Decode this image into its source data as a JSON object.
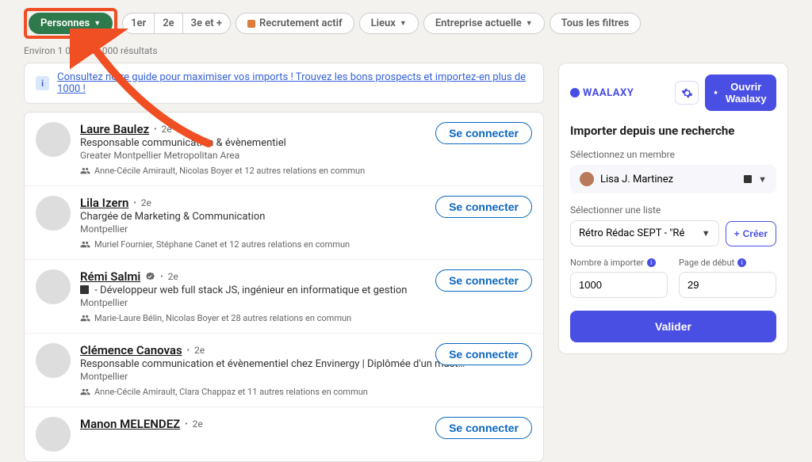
{
  "filters": {
    "primary": "Personnes",
    "seg1": "1er",
    "seg2": "2e",
    "seg3": "3e et +",
    "recruiting": "Recrutement actif",
    "locations": "Lieux",
    "company": "Entreprise actuelle",
    "all": "Tous les filtres"
  },
  "results_count": "Environ 1 080 000 000 résultats",
  "banner_text": "Consultez notre guide pour maximiser vos imports ! Trouvez les bons prospects et importez-en plus de 1000 !",
  "connect_label": "Se connecter",
  "results": [
    {
      "name": "Laure Baulez",
      "degree": "2e",
      "verified": false,
      "title_prefix": "",
      "title": "Responsable communication & évènementiel",
      "location": "Greater Montpellier Metropolitan Area",
      "mutual": "Anne-Cécile Amirault, Nicolas Boyer et 12 autres relations en commun"
    },
    {
      "name": "Lila Izern",
      "degree": "2e",
      "verified": false,
      "title_prefix": "",
      "title": "Chargée de Marketing & Communication",
      "location": "Montpellier",
      "mutual": "Muriel Fournier, Stéphane Canet et 12 autres relations en commun"
    },
    {
      "name": "Rémi Salmi",
      "degree": "2e",
      "verified": true,
      "title_prefix": "dark",
      "title": " - Développeur web full stack JS, ingénieur en informatique et gestion",
      "location": "Montpellier",
      "mutual": "Marie-Laure Bélin, Nicolas Boyer et 28 autres relations en commun"
    },
    {
      "name": "Clémence Canovas",
      "degree": "2e",
      "verified": false,
      "title_prefix": "",
      "title": "Responsable communication et évènementiel chez Envinergy | Diplômée d'un mast…",
      "location": "Montpellier",
      "mutual": "Anne-Cécile Amirault, Clara Chappaz et 11 autres relations en commun"
    },
    {
      "name": "Manon MELENDEZ",
      "degree": "2e",
      "verified": false,
      "title_prefix": "",
      "title": "",
      "location": "",
      "mutual": ""
    }
  ],
  "sidebar": {
    "brand": "WAALAXY",
    "open_btn": "Ouvrir Waalaxy",
    "import_heading": "Importer depuis une recherche",
    "member_label": "Sélectionnez un membre",
    "member_value": "Lisa J. Martinez",
    "list_label": "Sélectionner une liste",
    "list_value": "Rétro Rédac SEPT - \"Ré",
    "create_btn": "Créer",
    "count_label": "Nombre à importer",
    "count_value": "1000",
    "page_label": "Page de début",
    "page_value": "29",
    "validate_btn": "Valider"
  }
}
